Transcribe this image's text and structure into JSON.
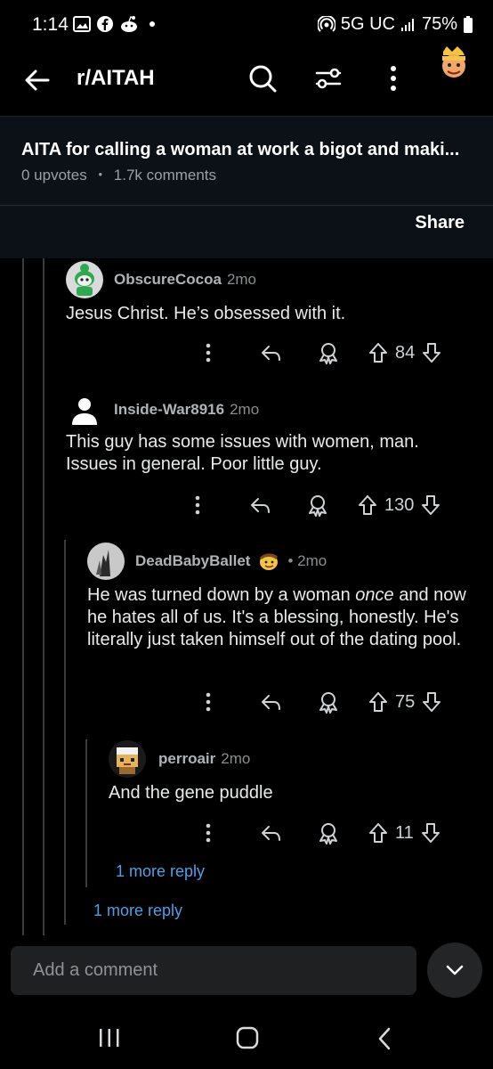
{
  "status": {
    "time": "1:14",
    "network": "5G UC",
    "battery": "75%"
  },
  "topbar": {
    "subreddit": "r/AITAH"
  },
  "post": {
    "title": "AITA for calling a woman at work a bigot and maki...",
    "upvotes": "0 upvotes",
    "dot": "•",
    "comments": "1.7k comments",
    "share": "Share"
  },
  "comments": [
    {
      "user": "ObscureCocoa",
      "time": "2mo",
      "body": "Jesus Christ. He’s obsessed with it.",
      "votes": "84"
    },
    {
      "user": "Inside-War8916",
      "time": "2mo",
      "body": "This guy has some issues with women, man. Issues in general.  Poor little guy.",
      "votes": "130"
    },
    {
      "user": "DeadBabyBallet",
      "time": "• 2mo",
      "body_pre": "He was turned down by a woman ",
      "body_em": "once",
      "body_post": " and now he hates all of us. It's a blessing, honestly. He's literally just taken himself out of the dating pool.",
      "votes": "75"
    },
    {
      "user": "perroair",
      "time": "2mo",
      "body": "And the gene puddle",
      "votes": "11"
    }
  ],
  "more_replies": [
    "1 more reply",
    "1 more reply"
  ],
  "composer": {
    "placeholder": "Add a comment"
  },
  "colors": {
    "link": "#4f9fe8",
    "background": "#000000",
    "header_bg": "#0b1116"
  }
}
